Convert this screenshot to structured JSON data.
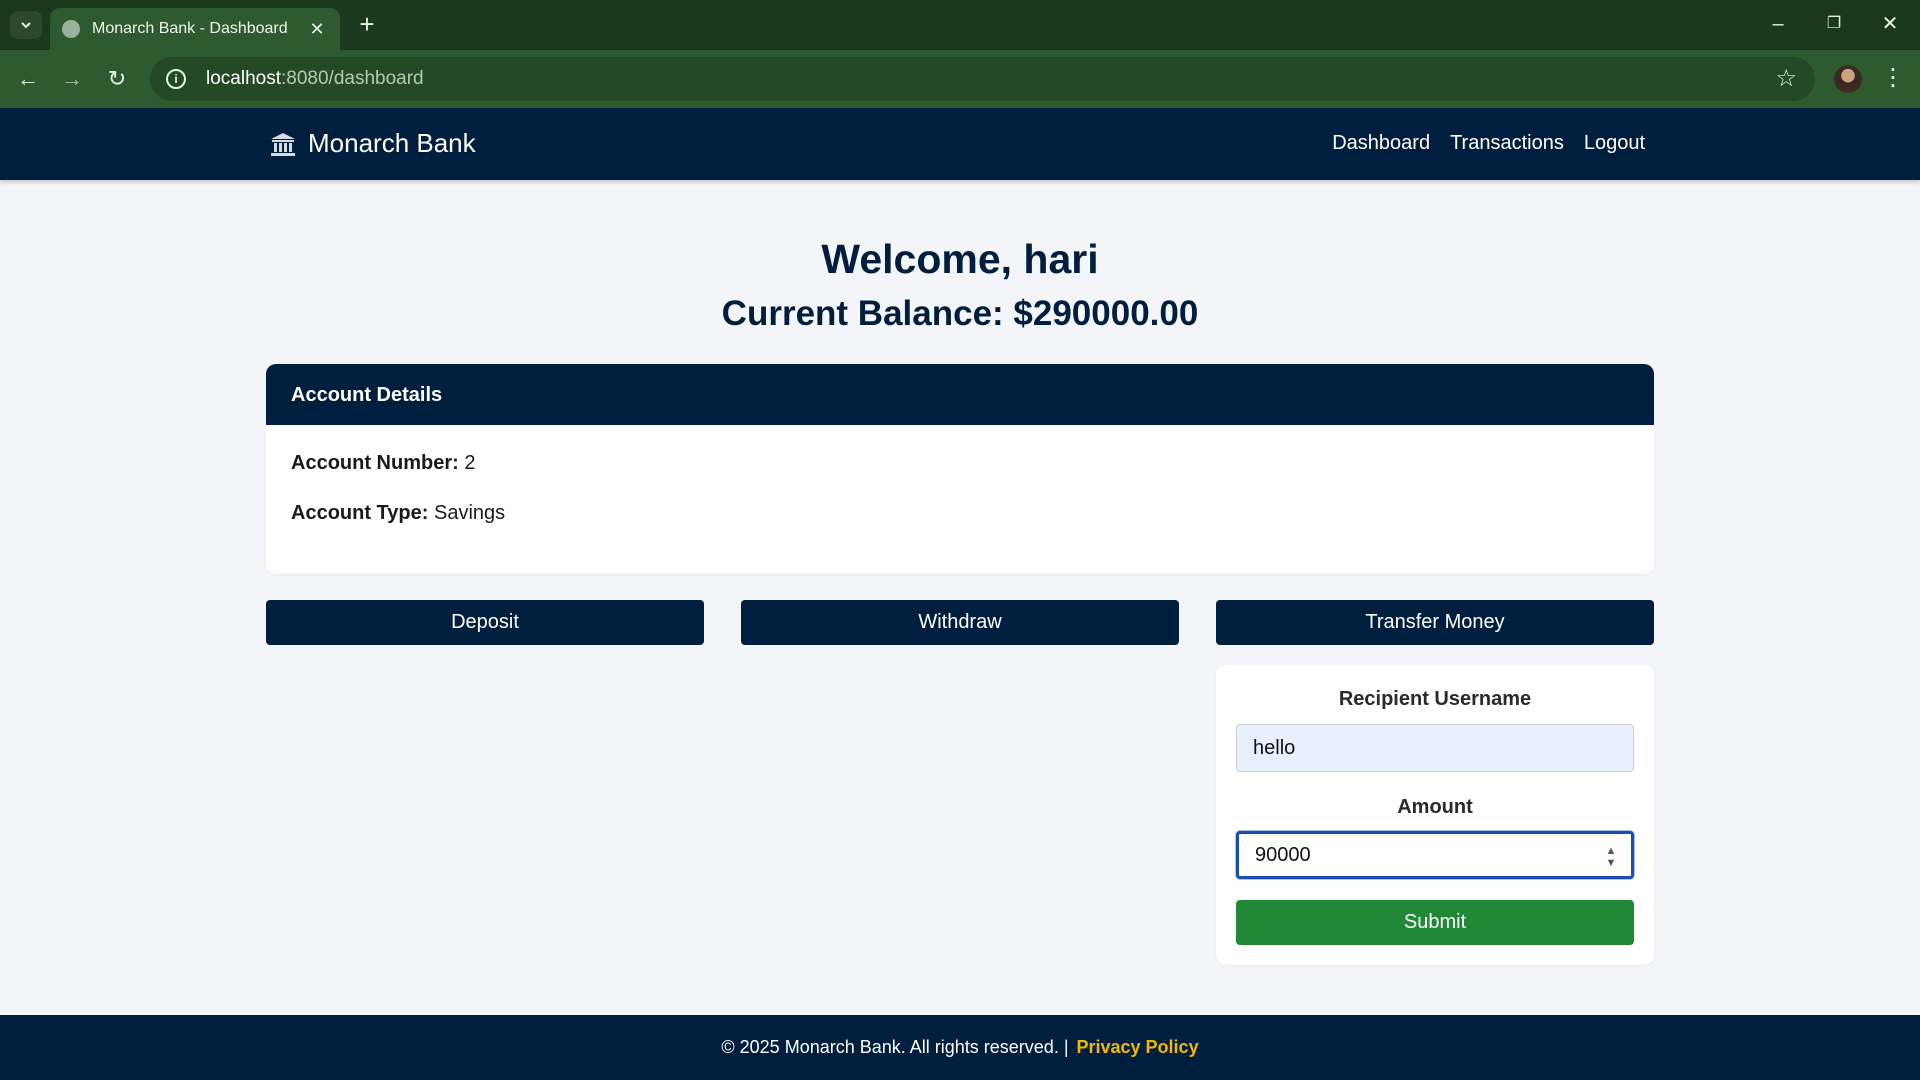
{
  "browser": {
    "tab_title": "Monarch Bank - Dashboard",
    "url_host": "localhost",
    "url_rest": ":8080/dashboard"
  },
  "nav": {
    "brand": "Monarch Bank",
    "links": [
      "Dashboard",
      "Transactions",
      "Logout"
    ]
  },
  "main": {
    "welcome": "Welcome, hari",
    "balance": "Current Balance: $290000.00"
  },
  "account": {
    "header": "Account Details",
    "number_label": "Account Number:",
    "number_value": "2",
    "type_label": "Account Type:",
    "type_value": "Savings"
  },
  "actions": {
    "deposit": "Deposit",
    "withdraw": "Withdraw",
    "transfer": "Transfer Money"
  },
  "transfer_form": {
    "recipient_label": "Recipient Username",
    "recipient_value": "hello",
    "amount_label": "Amount",
    "amount_value": "90000",
    "submit": "Submit"
  },
  "footer": {
    "text": "© 2025 Monarch Bank. All rights reserved. |",
    "privacy": "Privacy Policy"
  },
  "colors": {
    "navy": "#001f3f",
    "submit_green": "#218838",
    "privacy_link": "#f5b800"
  }
}
